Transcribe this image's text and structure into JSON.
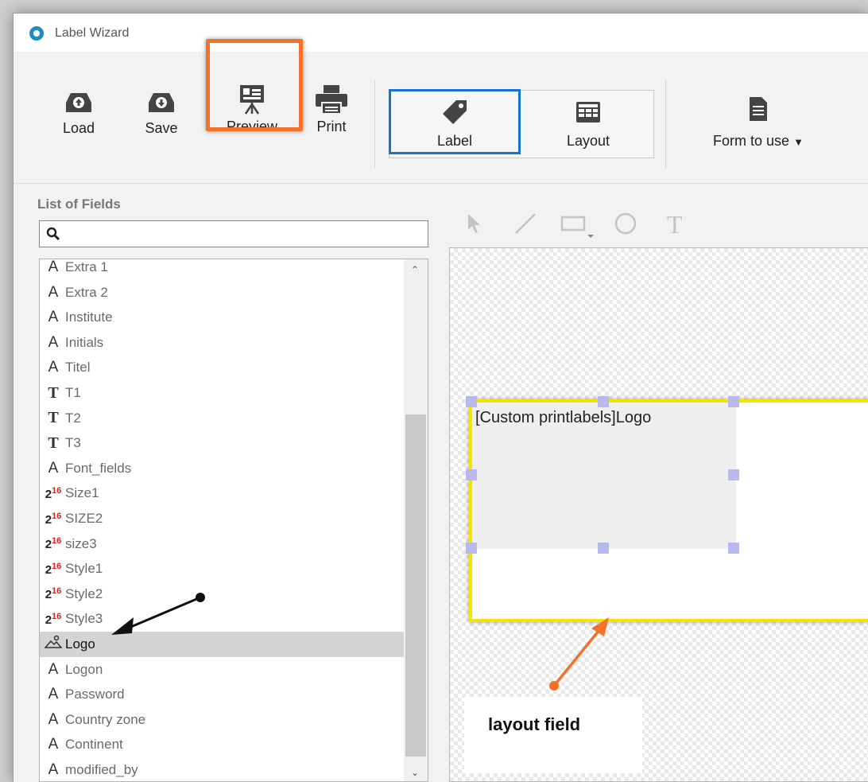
{
  "window": {
    "title": "Label Wizard"
  },
  "toolbar": {
    "load": "Load",
    "save": "Save",
    "preview": "Preview",
    "print": "Print",
    "label": "Label",
    "layout": "Layout",
    "form_to_use": "Form to use"
  },
  "fields_panel": {
    "title": "List of Fields",
    "search_placeholder": "",
    "items": [
      {
        "type": "A",
        "label": "Extra 1"
      },
      {
        "type": "A",
        "label": "Extra 2"
      },
      {
        "type": "A",
        "label": "Institute"
      },
      {
        "type": "A",
        "label": "Initials"
      },
      {
        "type": "A",
        "label": "Titel"
      },
      {
        "type": "T",
        "label": "T1"
      },
      {
        "type": "T",
        "label": "T2"
      },
      {
        "type": "T",
        "label": "T3"
      },
      {
        "type": "A",
        "label": "Font_fields"
      },
      {
        "type": "N",
        "label": "Size1"
      },
      {
        "type": "N",
        "label": "SIZE2"
      },
      {
        "type": "N",
        "label": "size3"
      },
      {
        "type": "N",
        "label": "Style1"
      },
      {
        "type": "N",
        "label": "Style2"
      },
      {
        "type": "N",
        "label": "Style3"
      },
      {
        "type": "IMG",
        "label": "Logo",
        "selected": true
      },
      {
        "type": "A",
        "label": "Logon"
      },
      {
        "type": "A",
        "label": "Password"
      },
      {
        "type": "A",
        "label": "Country zone"
      },
      {
        "type": "A",
        "label": "Continent"
      },
      {
        "type": "A",
        "label": "modified_by"
      }
    ]
  },
  "icons": {
    "text_field": "A",
    "text_field_T": "T",
    "numeric_base": "2",
    "numeric_exp": "16"
  },
  "canvas": {
    "layout_field_text": "[Custom printlabels]Logo",
    "annotation": "layout field"
  },
  "colors": {
    "preview_highlight": "#f0732a",
    "mode_selected": "#1473d3",
    "label_border": "#f4e400",
    "handles": "#b9b9ee"
  }
}
